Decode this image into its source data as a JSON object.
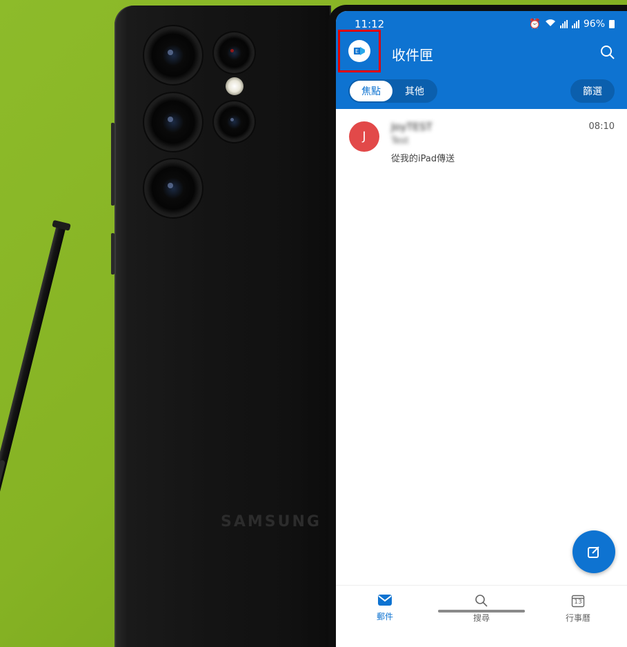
{
  "status_bar": {
    "time": "11:12",
    "battery_text": "96%"
  },
  "header": {
    "title": "收件匣",
    "account_icon": "outlook-exchange-icon"
  },
  "focus_tabs": {
    "focused": "焦點",
    "other": "其他"
  },
  "filter_label": "篩選",
  "messages": [
    {
      "avatar_letter": "J",
      "sender": "JoyTEST",
      "subject": "Test",
      "preview": "從我的iPad傳送",
      "time": "08:10"
    }
  ],
  "bottom_nav": {
    "mail": "郵件",
    "search": "搜尋",
    "calendar": "行事曆",
    "calendar_day": "13"
  },
  "device": {
    "brand": "SAMSUNG"
  },
  "colors": {
    "accent": "#0e73d1",
    "avatar": "#e24949",
    "highlight": "#e00000",
    "background": "#86b324"
  }
}
